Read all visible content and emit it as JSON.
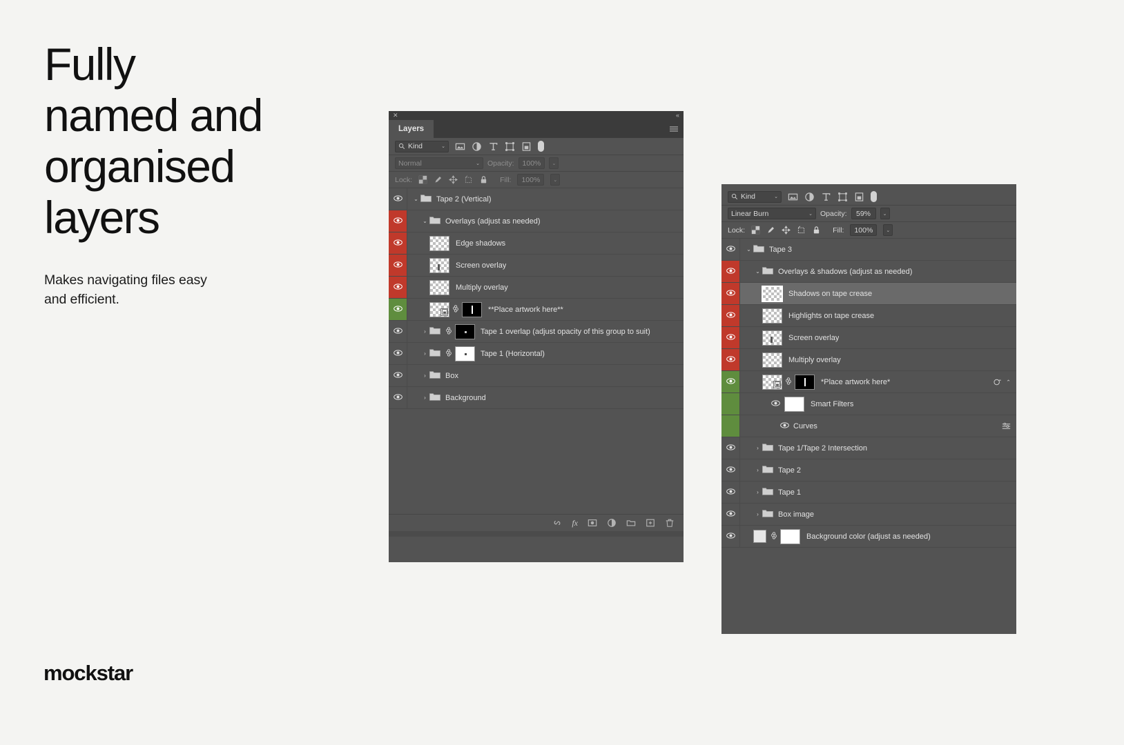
{
  "marketing": {
    "headline": "Fully\nnamed and\norganised\nlayers",
    "subcopy": "Makes navigating files easy\nand efficient.",
    "brand": "mockstar"
  },
  "left_panel": {
    "titlebar": {
      "close_label": "✕",
      "collapse_label": "«"
    },
    "tab_label": "Layers",
    "menu_icon": "panel-menu-icon",
    "filter_row": {
      "kind_label": "Kind",
      "search_icon": "search-icon",
      "caret": "⌄",
      "icons": [
        "pixel-layer-filter-icon",
        "adjustment-layer-filter-icon",
        "type-layer-filter-icon",
        "shape-layer-filter-icon",
        "smart-object-filter-icon"
      ],
      "toggle": "filter-toggle-switch"
    },
    "blend_row": {
      "blend_mode": "Normal",
      "opacity_label": "Opacity:",
      "opacity_value": "100%",
      "dimmed": true
    },
    "lock_row": {
      "lock_label": "Lock:",
      "icons": [
        "lock-transparent-pixels-icon",
        "lock-image-pixels-icon",
        "lock-position-icon",
        "lock-artboard-nesting-icon",
        "lock-all-icon"
      ],
      "fill_label": "Fill:",
      "fill_value": "100%",
      "dimmed": true
    },
    "layers": [
      {
        "name": "Tape 2 (Vertical)",
        "type": "group",
        "indent": 0,
        "expanded": true,
        "flag": "none",
        "visible": true
      },
      {
        "name": "Overlays (adjust as needed)",
        "type": "group",
        "indent": 1,
        "expanded": true,
        "flag": "red",
        "visible": true
      },
      {
        "name": "Edge shadows",
        "type": "pixel",
        "indent": 2,
        "flag": "red",
        "visible": true
      },
      {
        "name": "Screen overlay",
        "type": "pixel-mark",
        "indent": 2,
        "flag": "red",
        "visible": true
      },
      {
        "name": "Multiply overlay",
        "type": "pixel",
        "indent": 2,
        "flag": "red",
        "visible": true
      },
      {
        "name": "**Place artwork here**",
        "type": "smart-object-masked",
        "indent": 2,
        "flag": "green",
        "visible": true
      },
      {
        "name": "Tape 1 overlap (adjust opacity of this group to suit)",
        "type": "group-masked-black",
        "indent": 1,
        "flag": "none",
        "visible": true
      },
      {
        "name": "Tape 1 (Horizontal)",
        "type": "group-masked-white",
        "indent": 1,
        "flag": "none",
        "visible": true
      },
      {
        "name": "Box",
        "type": "group",
        "indent": 1,
        "flag": "none",
        "visible": true
      },
      {
        "name": "Background",
        "type": "group",
        "indent": 1,
        "flag": "none",
        "visible": true
      }
    ],
    "footer_icons": [
      "link-layers-icon",
      "layer-style-fx-icon",
      "add-layer-mask-icon",
      "new-adjustment-layer-icon",
      "new-group-icon",
      "new-layer-icon",
      "delete-layer-icon"
    ],
    "footer_fx_label": "fx"
  },
  "right_panel": {
    "filter_row": {
      "kind_label": "Kind",
      "search_icon": "search-icon",
      "caret": "⌄",
      "icons": [
        "pixel-layer-filter-icon",
        "adjustment-layer-filter-icon",
        "type-layer-filter-icon",
        "shape-layer-filter-icon",
        "smart-object-filter-icon"
      ],
      "toggle": "filter-toggle-switch"
    },
    "blend_row": {
      "blend_mode": "Linear Burn",
      "opacity_label": "Opacity:",
      "opacity_value": "59%"
    },
    "lock_row": {
      "lock_label": "Lock:",
      "icons": [
        "lock-transparent-pixels-icon",
        "lock-image-pixels-icon",
        "lock-position-icon",
        "lock-artboard-nesting-icon",
        "lock-all-icon"
      ],
      "fill_label": "Fill:",
      "fill_value": "100%"
    },
    "layers": [
      {
        "name": "Tape 3",
        "type": "group",
        "indent": 0,
        "expanded": true,
        "flag": "none",
        "visible": true
      },
      {
        "name": "Overlays & shadows (adjust as needed)",
        "type": "group",
        "indent": 1,
        "expanded": true,
        "flag": "red",
        "visible": true
      },
      {
        "name": "Shadows on tape crease",
        "type": "pixel",
        "indent": 2,
        "flag": "red",
        "visible": true,
        "selected": true
      },
      {
        "name": "Highlights on tape crease",
        "type": "pixel",
        "indent": 2,
        "flag": "red",
        "visible": true
      },
      {
        "name": "Screen overlay",
        "type": "pixel-mark",
        "indent": 2,
        "flag": "red",
        "visible": true
      },
      {
        "name": "Multiply overlay",
        "type": "pixel",
        "indent": 2,
        "flag": "red",
        "visible": true
      },
      {
        "name": "*Place artwork here*",
        "type": "smart-object-masked",
        "indent": 2,
        "flag": "green",
        "visible": true,
        "has_fx": true
      },
      {
        "name": "Smart Filters",
        "type": "smart-filters",
        "indent": 3,
        "flag": "green",
        "visible": true
      },
      {
        "name": "Curves",
        "type": "smart-filter-item",
        "indent": 4,
        "flag": "green",
        "visible": true
      },
      {
        "name": "Tape 1/Tape 2 Intersection",
        "type": "group",
        "indent": 1,
        "flag": "none",
        "visible": true
      },
      {
        "name": "Tape 2",
        "type": "group",
        "indent": 1,
        "flag": "none",
        "visible": true
      },
      {
        "name": "Tape 1",
        "type": "group",
        "indent": 1,
        "flag": "none",
        "visible": true
      },
      {
        "name": "Box image",
        "type": "group",
        "indent": 1,
        "flag": "none",
        "visible": true
      },
      {
        "name": "Background color (adjust as needed)",
        "type": "solid-fill-masked",
        "indent": 1,
        "flag": "none",
        "visible": true
      }
    ]
  },
  "colors": {
    "panel_bg": "#535353",
    "panel_chrome": "#3b3b3b",
    "flag_red": "#c0392b",
    "flag_green": "#5f8d3e",
    "selected_row": "#6a6a6a",
    "page_bg": "#f4f4f2",
    "text": "#e2e2e2"
  }
}
